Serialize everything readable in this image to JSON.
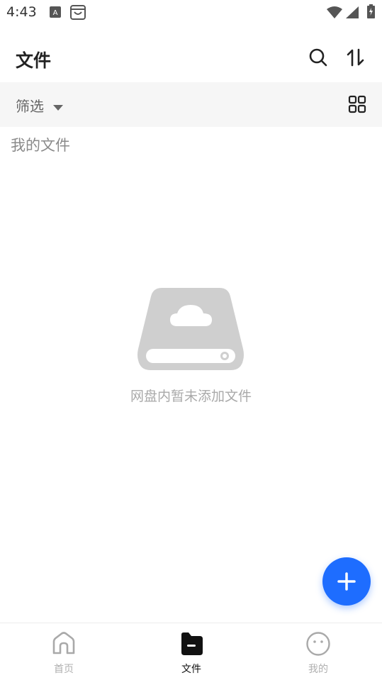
{
  "status_bar": {
    "time": "4:43",
    "icons": [
      "text-a-notification-icon",
      "store-bag-notification-icon",
      "wifi-icon",
      "cellular-signal-icon",
      "battery-charging-icon"
    ]
  },
  "app_bar": {
    "title": "文件",
    "actions": [
      "search-icon",
      "sort-icon"
    ]
  },
  "filter_bar": {
    "label": "筛选",
    "dropdown_icon": "caret-down-icon",
    "view_toggle_icon": "grid-view-icon"
  },
  "section": {
    "title": "我的文件"
  },
  "empty_state": {
    "illustration": "cloud-drive-icon",
    "message": "网盘内暂未添加文件"
  },
  "fab": {
    "icon": "plus-icon",
    "color": "#1e6dff"
  },
  "bottom_nav": {
    "items": [
      {
        "label": "首页",
        "icon": "home-icon",
        "active": false
      },
      {
        "label": "文件",
        "icon": "folder-icon",
        "active": true
      },
      {
        "label": "我的",
        "icon": "profile-face-icon",
        "active": false
      }
    ]
  },
  "colors": {
    "accent": "#1e6dff",
    "filter_bar_bg": "#f6f6f6",
    "inactive_label": "#b0b0b0"
  }
}
